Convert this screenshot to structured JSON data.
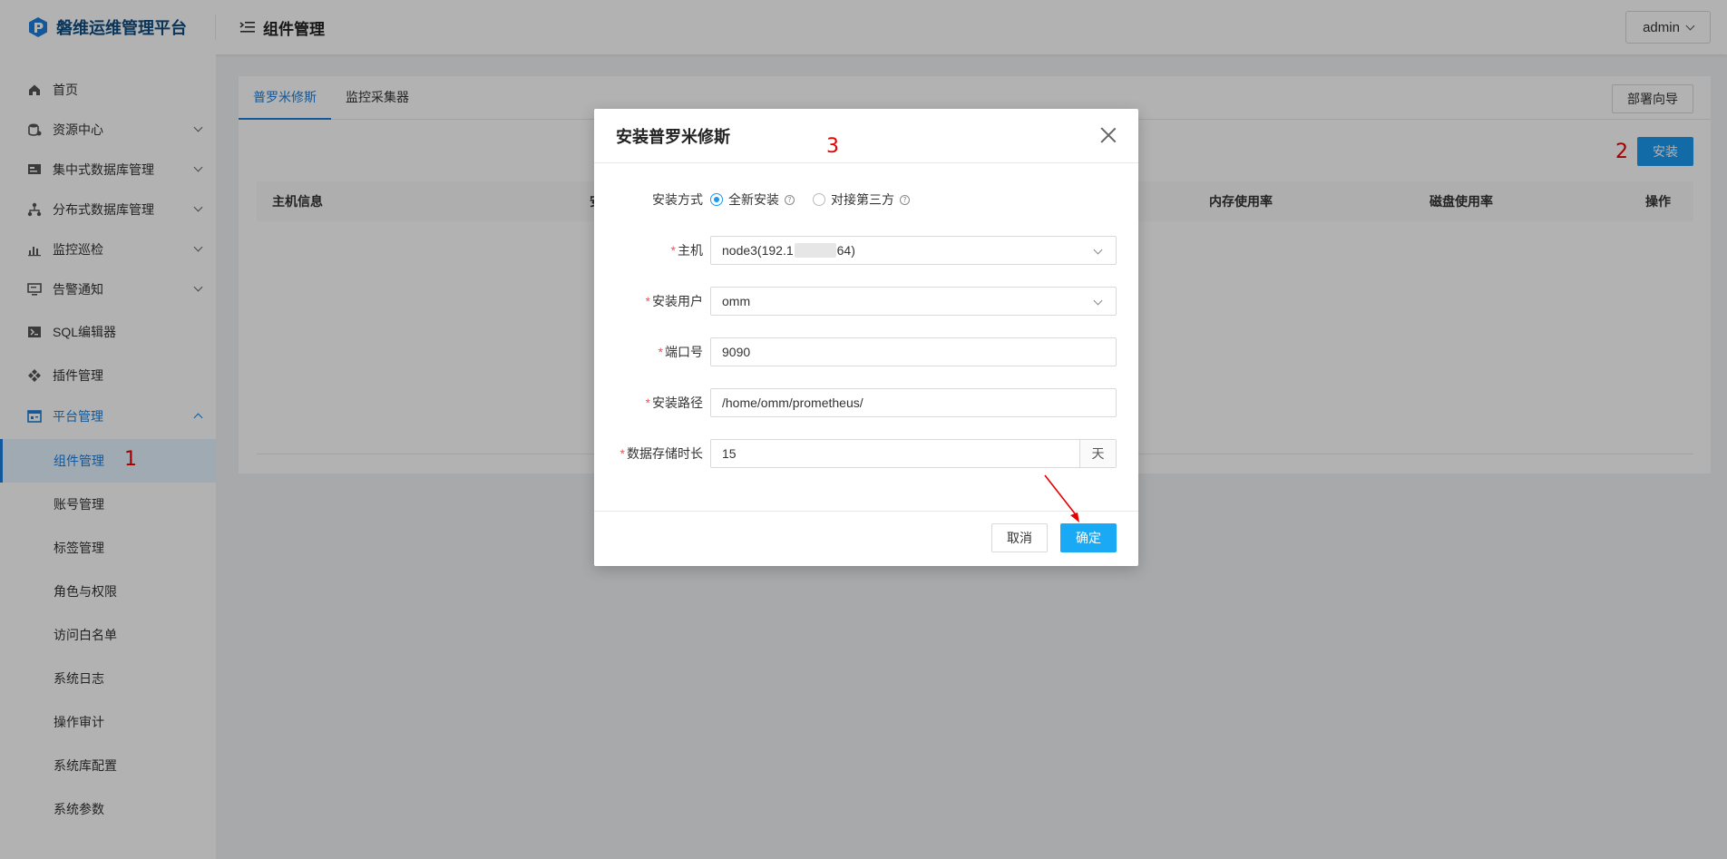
{
  "header": {
    "brand_name": "磐维运维管理平台",
    "page_title": "组件管理",
    "user": "admin"
  },
  "sidebar": {
    "items": [
      {
        "label": "首页",
        "icon": "home-icon"
      },
      {
        "label": "资源中心",
        "icon": "database-icon"
      },
      {
        "label": "集中式数据库管理",
        "icon": "db-manage-icon"
      },
      {
        "label": "分布式数据库管理",
        "icon": "distributed-icon"
      },
      {
        "label": "监控巡检",
        "icon": "chart-icon"
      },
      {
        "label": "告警通知",
        "icon": "monitor-icon"
      },
      {
        "label": "SQL编辑器",
        "icon": "terminal-icon"
      },
      {
        "label": "插件管理",
        "icon": "plugin-icon"
      },
      {
        "label": "平台管理",
        "icon": "platform-icon"
      }
    ],
    "sub_items": [
      {
        "label": "组件管理"
      },
      {
        "label": "账号管理"
      },
      {
        "label": "标签管理"
      },
      {
        "label": "角色与权限"
      },
      {
        "label": "访问白名单"
      },
      {
        "label": "系统日志"
      },
      {
        "label": "操作审计"
      },
      {
        "label": "系统库配置"
      },
      {
        "label": "系统参数"
      }
    ]
  },
  "content": {
    "tabs": [
      {
        "label": "普罗米修斯"
      },
      {
        "label": "监控采集器"
      }
    ],
    "deploy_button": "部署向导",
    "install_button": "安装",
    "columns": [
      "主机信息",
      "安装",
      "内存使用率",
      "磁盘使用率",
      "操作"
    ]
  },
  "annotations": [
    "1",
    "2",
    "3"
  ],
  "modal": {
    "title": "安装普罗米修斯",
    "install_mode_label": "安装方式",
    "install_mode_options": [
      "全新安装",
      "对接第三方"
    ],
    "install_mode_selected": "全新安装",
    "host_label": "主机",
    "host_prefix": "node3(192.1",
    "host_suffix": "64)",
    "user_label": "安装用户",
    "user_value": "omm",
    "port_label": "端口号",
    "port_value": "9090",
    "path_label": "安装路径",
    "path_value": "/home/omm/prometheus/",
    "retention_label": "数据存储时长",
    "retention_value": "15",
    "retention_unit": "天",
    "cancel": "取消",
    "ok": "确定"
  },
  "colors": {
    "primary": "#1a7fdd",
    "brand": "#0f4c81",
    "ok_button": "#1aaaf5",
    "annotation": "#e60000"
  }
}
